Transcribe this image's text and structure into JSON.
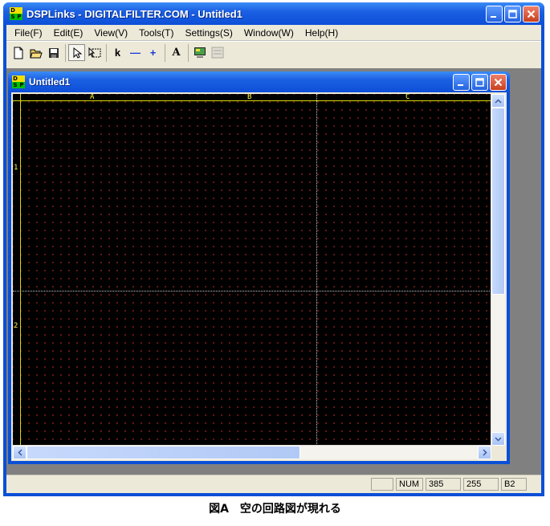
{
  "app": {
    "title": "DSPLinks - DIGITALFILTER.COM - Untitled1",
    "icon_letters": [
      "D",
      "S",
      "P",
      ""
    ]
  },
  "menu": [
    "File(F)",
    "Edit(E)",
    "View(V)",
    "Tools(T)",
    "Settings(S)",
    "Window(W)",
    "Help(H)"
  ],
  "toolbar": {
    "text_tool": "A",
    "wire_h": "—",
    "junction": "+",
    "label_tool": "k"
  },
  "child": {
    "title": "Untitled1"
  },
  "canvas": {
    "columns": [
      "A",
      "B",
      "C"
    ],
    "rows": [
      "1",
      "2"
    ]
  },
  "status": {
    "num": "NUM",
    "x": "385",
    "y": "255",
    "cell": "B2"
  },
  "caption": "図A　空の回路図が現れる",
  "colors": {
    "titlebar": "#1b5fe3",
    "canvas_bg": "#000000",
    "grid_dot": "#7a1a12",
    "frame": "#d8d800"
  }
}
